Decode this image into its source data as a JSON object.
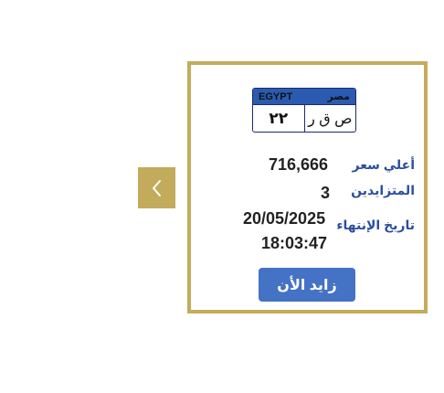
{
  "nav": {
    "prev_icon": "chevron-left-icon"
  },
  "plate": {
    "country_en": "EGYPT",
    "country_ar": "مصر",
    "numbers": "٢٢",
    "letters": "ص ق ر"
  },
  "details": {
    "highest_price_label": "أعلي سعر",
    "highest_price_value": "716,666",
    "bidders_label": "المتزايدين",
    "bidders_value": "3",
    "end_date_label": "تاريخ الإنتهاء",
    "end_date_value": "20/05/2025",
    "end_time_value": "18:03:47"
  },
  "actions": {
    "bid_label": "زايد الأن"
  },
  "colors": {
    "border_gold": "#c3ac5c",
    "nav_gold": "#c2ab5a",
    "label_blue": "#2c4f9e",
    "button_blue": "#4472c4",
    "plate_header_blue": "#2a5bb0"
  }
}
